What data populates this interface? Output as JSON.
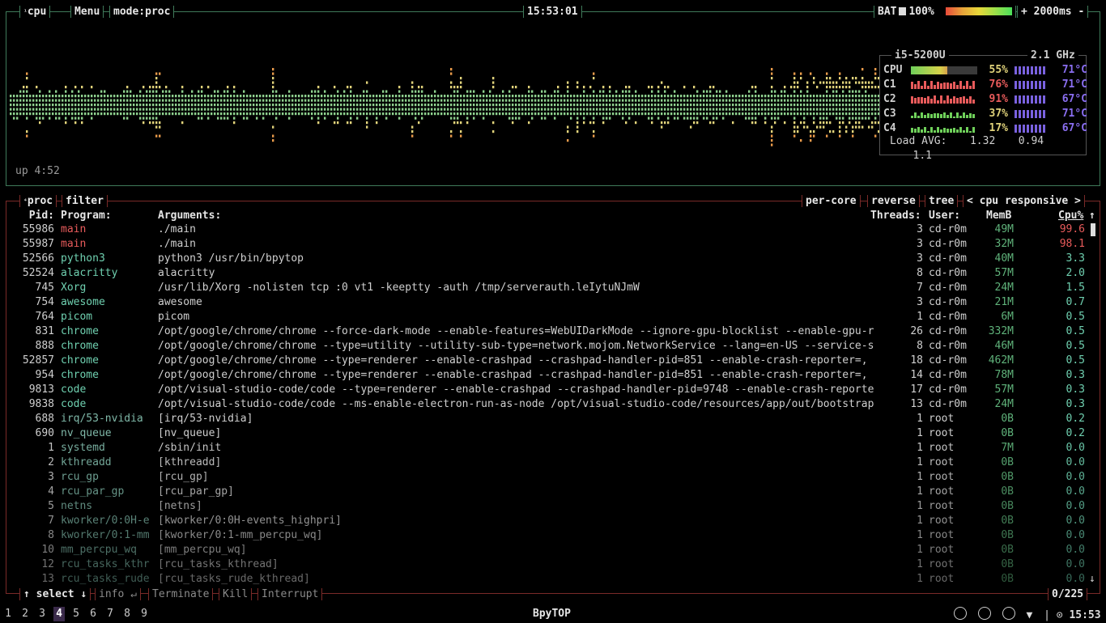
{
  "header": {
    "cpu_tag": "cpu",
    "cpu_tag_num": "¹",
    "menu": "Menu",
    "mode": "mode:proc",
    "clock": "15:53:01",
    "bat_label": "BAT",
    "bat_pct": "100%",
    "update": "+ 2000ms -"
  },
  "uptime": "up 4:52",
  "cpu_panel": {
    "model": "i5-5200U",
    "freq": "2.1 GHz",
    "rows": [
      {
        "label": "CPU",
        "pct": "55%",
        "temp": "71°C",
        "hot": false
      },
      {
        "label": "C1",
        "pct": "76%",
        "temp": "71°C",
        "hot": true
      },
      {
        "label": "C2",
        "pct": "91%",
        "temp": "67°C",
        "hot": true
      },
      {
        "label": "C3",
        "pct": "37%",
        "temp": "71°C",
        "hot": false
      },
      {
        "label": "C4",
        "pct": "17%",
        "temp": "67°C",
        "hot": false
      }
    ],
    "load_label": "Load AVG:",
    "load": [
      "1.32",
      "0.94",
      "1.1"
    ]
  },
  "proc_bar": {
    "proc_tag": "proc",
    "proc_num": "⁴",
    "filter": "filter",
    "per_core": "per-core",
    "reverse": "reverse",
    "tree": "tree",
    "sort": "< cpu responsive >"
  },
  "columns": {
    "pid": "Pid:",
    "program": "Program:",
    "args": "Arguments:",
    "threads": "Threads:",
    "user": "User:",
    "mem": "MemB",
    "cpu": "Cpu%",
    "arrow": "↑"
  },
  "processes": [
    {
      "pid": "55986",
      "prog": "main",
      "args": "./main",
      "thr": "3",
      "user": "cd-r0m",
      "mem": "49M",
      "cpu": "99.6",
      "hot": true
    },
    {
      "pid": "55987",
      "prog": "main",
      "args": "./main",
      "thr": "3",
      "user": "cd-r0m",
      "mem": "32M",
      "cpu": "98.1",
      "hot": true
    },
    {
      "pid": "52566",
      "prog": "python3",
      "args": "python3 /usr/bin/bpytop",
      "thr": "3",
      "user": "cd-r0m",
      "mem": "40M",
      "cpu": "3.3"
    },
    {
      "pid": "52524",
      "prog": "alacritty",
      "args": "alacritty",
      "thr": "8",
      "user": "cd-r0m",
      "mem": "57M",
      "cpu": "2.0"
    },
    {
      "pid": "745",
      "prog": "Xorg",
      "args": "/usr/lib/Xorg -nolisten tcp :0 vt1 -keeptty -auth /tmp/serverauth.leIytuNJmW",
      "thr": "7",
      "user": "cd-r0m",
      "mem": "24M",
      "cpu": "1.5"
    },
    {
      "pid": "754",
      "prog": "awesome",
      "args": "awesome",
      "thr": "3",
      "user": "cd-r0m",
      "mem": "21M",
      "cpu": "0.7"
    },
    {
      "pid": "764",
      "prog": "picom",
      "args": "picom",
      "thr": "1",
      "user": "cd-r0m",
      "mem": "6M",
      "cpu": "0.5"
    },
    {
      "pid": "831",
      "prog": "chrome",
      "args": "/opt/google/chrome/chrome --force-dark-mode --enable-features=WebUIDarkMode --ignore-gpu-blocklist --enable-gpu-r",
      "thr": "26",
      "user": "cd-r0m",
      "mem": "332M",
      "cpu": "0.5"
    },
    {
      "pid": "888",
      "prog": "chrome",
      "args": "/opt/google/chrome/chrome --type=utility --utility-sub-type=network.mojom.NetworkService --lang=en-US --service-s",
      "thr": "8",
      "user": "cd-r0m",
      "mem": "46M",
      "cpu": "0.5"
    },
    {
      "pid": "52857",
      "prog": "chrome",
      "args": "/opt/google/chrome/chrome --type=renderer --enable-crashpad --crashpad-handler-pid=851 --enable-crash-reporter=,",
      "thr": "18",
      "user": "cd-r0m",
      "mem": "462M",
      "cpu": "0.5"
    },
    {
      "pid": "954",
      "prog": "chrome",
      "args": "/opt/google/chrome/chrome --type=renderer --enable-crashpad --crashpad-handler-pid=851 --enable-crash-reporter=,",
      "thr": "14",
      "user": "cd-r0m",
      "mem": "78M",
      "cpu": "0.3"
    },
    {
      "pid": "9813",
      "prog": "code",
      "args": "/opt/visual-studio-code/code --type=renderer --enable-crashpad --crashpad-handler-pid=9748 --enable-crash-reporte",
      "thr": "17",
      "user": "cd-r0m",
      "mem": "57M",
      "cpu": "0.3"
    },
    {
      "pid": "9838",
      "prog": "code",
      "args": "/opt/visual-studio-code/code --ms-enable-electron-run-as-node /opt/visual-studio-code/resources/app/out/bootstrap",
      "thr": "13",
      "user": "cd-r0m",
      "mem": "24M",
      "cpu": "0.3"
    },
    {
      "pid": "688",
      "prog": "irq/53-nvidia",
      "args": "[irq/53-nvidia]",
      "thr": "1",
      "user": "root",
      "mem": "0B",
      "cpu": "0.2"
    },
    {
      "pid": "690",
      "prog": "nv_queue",
      "args": "[nv_queue]",
      "thr": "1",
      "user": "root",
      "mem": "0B",
      "cpu": "0.2"
    },
    {
      "pid": "1",
      "prog": "systemd",
      "args": "/sbin/init",
      "thr": "1",
      "user": "root",
      "mem": "7M",
      "cpu": "0.0"
    },
    {
      "pid": "2",
      "prog": "kthreadd",
      "args": "[kthreadd]",
      "thr": "1",
      "user": "root",
      "mem": "0B",
      "cpu": "0.0"
    },
    {
      "pid": "3",
      "prog": "rcu_gp",
      "args": "[rcu_gp]",
      "thr": "1",
      "user": "root",
      "mem": "0B",
      "cpu": "0.0"
    },
    {
      "pid": "4",
      "prog": "rcu_par_gp",
      "args": "[rcu_par_gp]",
      "thr": "1",
      "user": "root",
      "mem": "0B",
      "cpu": "0.0"
    },
    {
      "pid": "5",
      "prog": "netns",
      "args": "[netns]",
      "thr": "1",
      "user": "root",
      "mem": "0B",
      "cpu": "0.0"
    },
    {
      "pid": "7",
      "prog": "kworker/0:0H-e",
      "args": "[kworker/0:0H-events_highpri]",
      "thr": "1",
      "user": "root",
      "mem": "0B",
      "cpu": "0.0"
    },
    {
      "pid": "8",
      "prog": "kworker/0:1-mm",
      "args": "[kworker/0:1-mm_percpu_wq]",
      "thr": "1",
      "user": "root",
      "mem": "0B",
      "cpu": "0.0"
    },
    {
      "pid": "10",
      "prog": "mm_percpu_wq",
      "args": "[mm_percpu_wq]",
      "thr": "1",
      "user": "root",
      "mem": "0B",
      "cpu": "0.0"
    },
    {
      "pid": "12",
      "prog": "rcu_tasks_kthr",
      "args": "[rcu_tasks_kthread]",
      "thr": "1",
      "user": "root",
      "mem": "0B",
      "cpu": "0.0"
    },
    {
      "pid": "13",
      "prog": "rcu_tasks_rude",
      "args": "[rcu_tasks_rude_kthread]",
      "thr": "1",
      "user": "root",
      "mem": "0B",
      "cpu": "0.0"
    }
  ],
  "footer": {
    "select": "↑ select ↓",
    "info": "info ↵",
    "terminate": "Terminate",
    "kill": "Kill",
    "interrupt": "Interrupt",
    "count": "0/225"
  },
  "taskbar": {
    "workspaces": [
      "1",
      "2",
      "3",
      "4",
      "5",
      "6",
      "7",
      "8",
      "9"
    ],
    "active_workspace": "4",
    "title": "BpyTOP",
    "clock": "15:53",
    "icons": [
      "brightness-icon",
      "lock-icon",
      "volume-icon",
      "wifi-icon"
    ]
  },
  "colors": {
    "green": "#8ee08e",
    "yellow": "#e0d27a",
    "red": "#e85b5b",
    "purple": "#8a6ef0",
    "cyan": "#6fd0b0"
  }
}
